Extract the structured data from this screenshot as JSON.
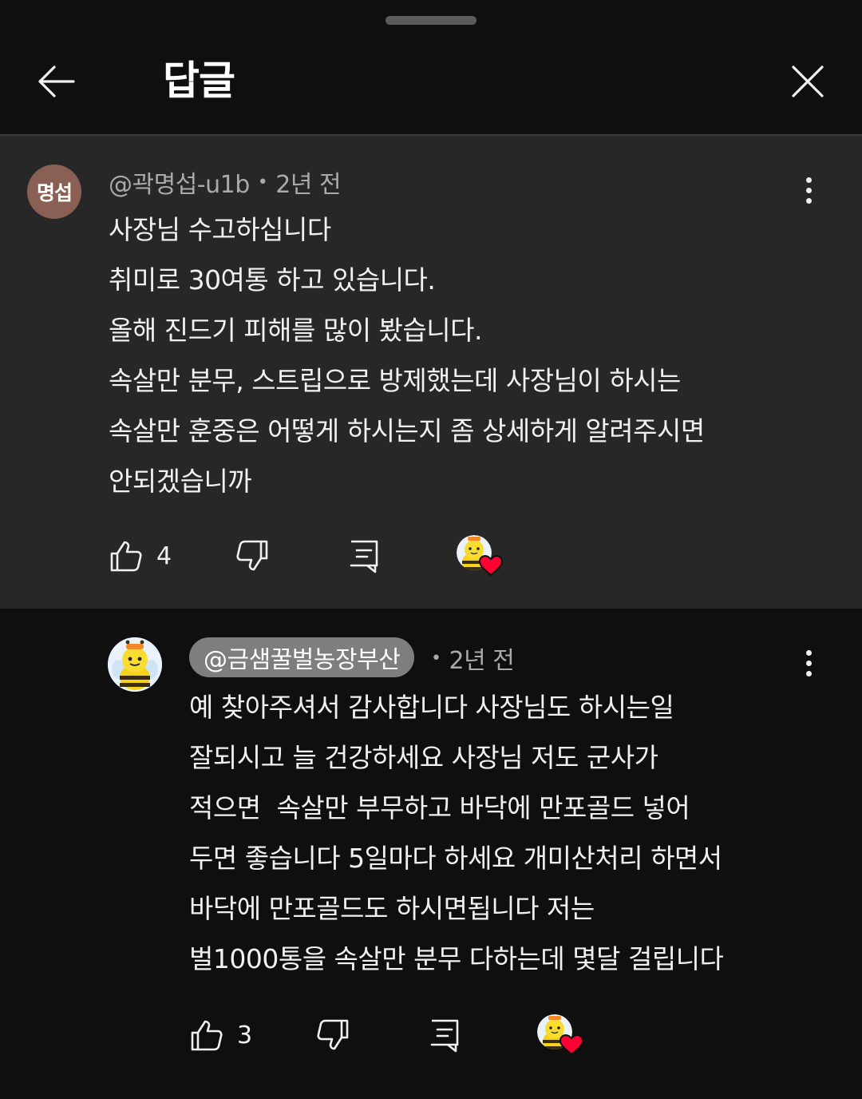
{
  "header": {
    "title": "답글"
  },
  "parent_comment": {
    "avatar_text": "명섭",
    "author": "@곽명섭-u1b",
    "time": "2년 전",
    "lines": [
      "사장님 수고하십니다",
      "취미로 30여통 하고 있습니다.",
      "올해 진드기 피해를 많이 봤습니다.",
      "속살만 분무, 스트립으로 방제했는데 사장님이 하시는",
      "속살만 훈중은 어떻게 하시는지 좀 상세하게 알려주시면",
      "안되겠습니까"
    ],
    "like_count": "4"
  },
  "reply_comment": {
    "author": "@금샘꿀벌농장부산",
    "time": "2년 전",
    "lines": [
      "예 찾아주셔서 감사합니다 사장님도 하시는일",
      "잘되시고 늘 건강하세요 사장님 저도 군사가",
      "적으면  속살만 부무하고 바닥에 만포골드 넣어",
      "두면 좋습니다 5일마다 하세요 개미산처리 하면서",
      "바닥에 만포골드도 하시면됩니다 저는",
      "벌1000통을 속살만 분무 다하는데 몇달 걸립니다"
    ],
    "like_count": "3"
  },
  "colors": {
    "background": "#0f0f0f",
    "parent_background": "#272727",
    "creator_chip": "#7e7e7e",
    "heart": "#ff0033",
    "meta_text": "#aaaaaa"
  },
  "icons": {
    "back": "arrow-left-icon",
    "close": "close-icon",
    "more": "more-vertical-icon",
    "like": "thumbs-up-icon",
    "dislike": "thumbs-down-icon",
    "reply": "reply-icon",
    "creator_heart": "creator-heart-icon"
  }
}
